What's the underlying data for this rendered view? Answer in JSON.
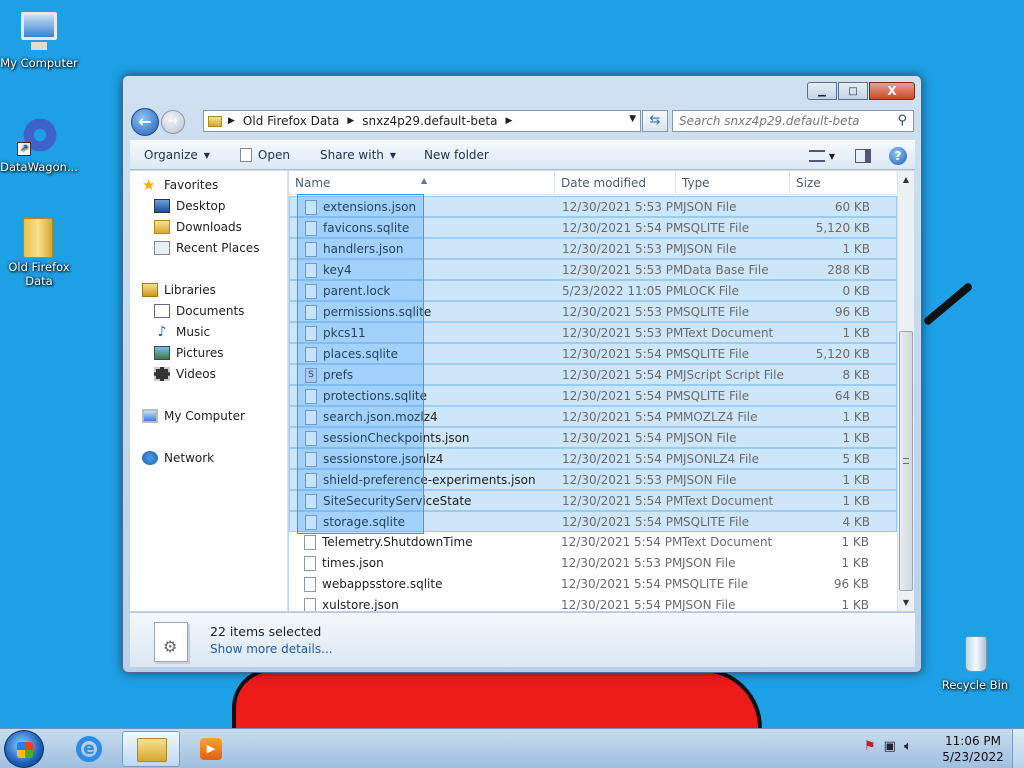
{
  "desktop": {
    "icons": [
      {
        "label": "My Computer"
      },
      {
        "label": "DataWagon..."
      },
      {
        "label": "Old Firefox Data"
      },
      {
        "label": "Recycle Bin"
      }
    ]
  },
  "window": {
    "controls": {
      "minimize": "▁",
      "maximize": "□",
      "close": "X"
    },
    "address": {
      "crumbs": [
        "Old Firefox Data",
        "snxz4p29.default-beta"
      ]
    },
    "search": {
      "placeholder": "Search snxz4p29.default-beta"
    },
    "toolbar": {
      "organize": "Organize",
      "open": "Open",
      "share_with": "Share with",
      "new_folder": "New folder"
    },
    "nav_pane": {
      "favorites": "Favorites",
      "desktop": "Desktop",
      "downloads": "Downloads",
      "recent_places": "Recent Places",
      "libraries": "Libraries",
      "documents": "Documents",
      "music": "Music",
      "pictures": "Pictures",
      "videos": "Videos",
      "my_computer": "My Computer",
      "network": "Network"
    },
    "columns": {
      "name": "Name",
      "date": "Date modified",
      "type": "Type",
      "size": "Size"
    },
    "files": [
      {
        "name": "extensions.json",
        "date": "12/30/2021 5:53 PM",
        "type": "JSON File",
        "size": "60 KB",
        "selected": true
      },
      {
        "name": "favicons.sqlite",
        "date": "12/30/2021 5:54 PM",
        "type": "SQLITE File",
        "size": "5,120 KB",
        "selected": true
      },
      {
        "name": "handlers.json",
        "date": "12/30/2021 5:53 PM",
        "type": "JSON File",
        "size": "1 KB",
        "selected": true
      },
      {
        "name": "key4",
        "date": "12/30/2021 5:53 PM",
        "type": "Data Base File",
        "size": "288 KB",
        "selected": true
      },
      {
        "name": "parent.lock",
        "date": "5/23/2022 11:05 PM",
        "type": "LOCK File",
        "size": "0 KB",
        "selected": true
      },
      {
        "name": "permissions.sqlite",
        "date": "12/30/2021 5:53 PM",
        "type": "SQLITE File",
        "size": "96 KB",
        "selected": true
      },
      {
        "name": "pkcs11",
        "date": "12/30/2021 5:53 PM",
        "type": "Text Document",
        "size": "1 KB",
        "selected": true
      },
      {
        "name": "places.sqlite",
        "date": "12/30/2021 5:54 PM",
        "type": "SQLITE File",
        "size": "5,120 KB",
        "selected": true
      },
      {
        "name": "prefs",
        "date": "12/30/2021 5:54 PM",
        "type": "JScript Script File",
        "size": "8 KB",
        "selected": true
      },
      {
        "name": "protections.sqlite",
        "date": "12/30/2021 5:54 PM",
        "type": "SQLITE File",
        "size": "64 KB",
        "selected": true
      },
      {
        "name": "search.json.mozlz4",
        "date": "12/30/2021 5:54 PM",
        "type": "MOZLZ4 File",
        "size": "1 KB",
        "selected": true
      },
      {
        "name": "sessionCheckpoints.json",
        "date": "12/30/2021 5:54 PM",
        "type": "JSON File",
        "size": "1 KB",
        "selected": true
      },
      {
        "name": "sessionstore.jsonlz4",
        "date": "12/30/2021 5:54 PM",
        "type": "JSONLZ4 File",
        "size": "5 KB",
        "selected": true
      },
      {
        "name": "shield-preference-experiments.json",
        "date": "12/30/2021 5:53 PM",
        "type": "JSON File",
        "size": "1 KB",
        "selected": true
      },
      {
        "name": "SiteSecurityServiceState",
        "date": "12/30/2021 5:54 PM",
        "type": "Text Document",
        "size": "1 KB",
        "selected": true
      },
      {
        "name": "storage.sqlite",
        "date": "12/30/2021 5:54 PM",
        "type": "SQLITE File",
        "size": "4 KB",
        "selected": true
      },
      {
        "name": "Telemetry.ShutdownTime",
        "date": "12/30/2021 5:54 PM",
        "type": "Text Document",
        "size": "1 KB",
        "selected": false
      },
      {
        "name": "times.json",
        "date": "12/30/2021 5:53 PM",
        "type": "JSON File",
        "size": "1 KB",
        "selected": false
      },
      {
        "name": "webappsstore.sqlite",
        "date": "12/30/2021 5:54 PM",
        "type": "SQLITE File",
        "size": "96 KB",
        "selected": false
      },
      {
        "name": "xulstore.json",
        "date": "12/30/2021 5:54 PM",
        "type": "JSON File",
        "size": "1 KB",
        "selected": false
      }
    ],
    "details": {
      "count": "22 items selected",
      "more": "Show more details..."
    }
  },
  "taskbar": {
    "clock_time": "11:06 PM",
    "clock_date": "5/23/2022"
  }
}
